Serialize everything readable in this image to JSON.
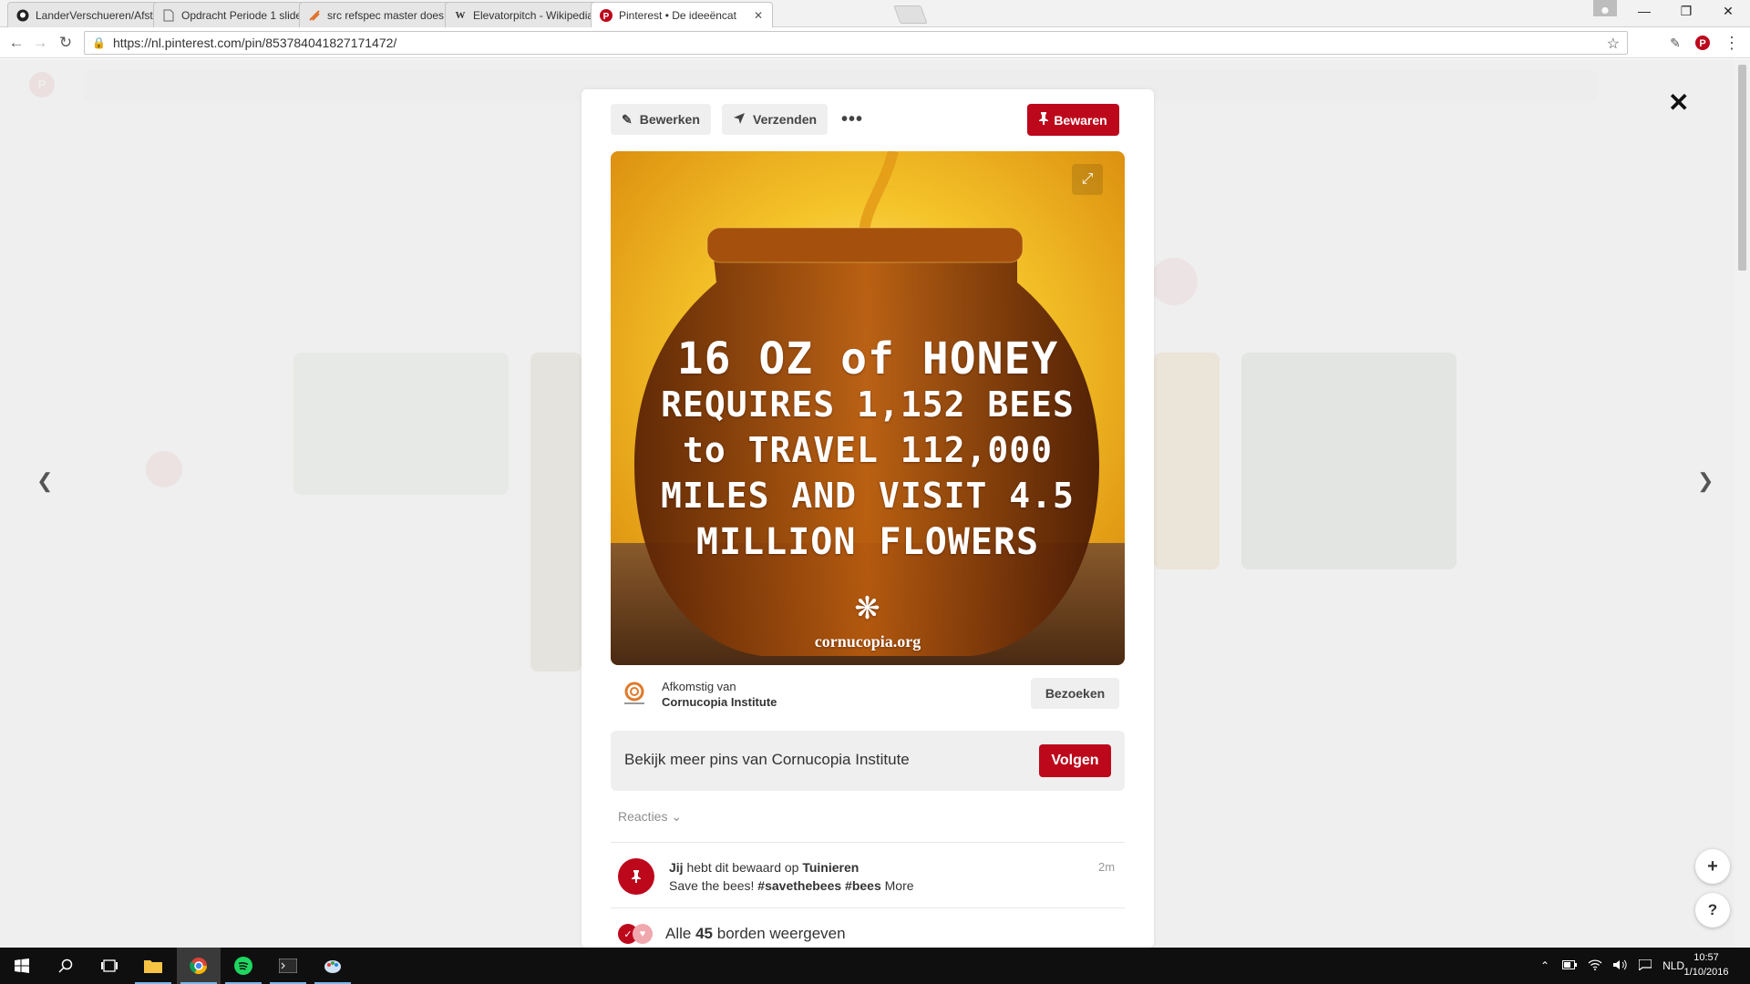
{
  "browser": {
    "tabs": [
      {
        "icon": "github-icon",
        "title": "LanderVerschueren/Afstu"
      },
      {
        "icon": "document-icon",
        "title": "Opdracht Periode 1 slide"
      },
      {
        "icon": "sourcetree-icon",
        "title": "src refspec master does n"
      },
      {
        "icon": "wikipedia-icon",
        "title": "Elevatorpitch - Wikipedia"
      },
      {
        "icon": "pinterest-icon",
        "title": "Pinterest • De ideeëncat"
      }
    ],
    "active_tab": 4,
    "url": "https://nl.pinterest.com/pin/853784041827171472/"
  },
  "modal": {
    "toolbar": {
      "edit_label": "Bewerken",
      "send_label": "Verzenden",
      "more_label": "•••",
      "save_label": "Bewaren"
    },
    "image": {
      "lines": [
        "16 OZ of HONEY",
        "REQUIRES 1,152 BEES",
        "to TRAVEL 112,000",
        "MILES AND VISIT 4.5",
        "MILLION FLOWERS"
      ],
      "website": "cornucopia.org"
    },
    "source": {
      "from_label": "Afkomstig van",
      "name": "Cornucopia Institute",
      "visit_label": "Bezoeken"
    },
    "more_pins": {
      "text": "Bekijk meer pins van Cornucopia Institute",
      "follow_label": "Volgen"
    },
    "reactions_label": "Reacties",
    "activity": {
      "user": "Jij",
      "text": "hebt dit bewaard op",
      "board": "Tuinieren",
      "time": "2m",
      "note_plain": "Save the bees!",
      "hashtags": "#savethebees #bees",
      "more_label": "More"
    },
    "boards": {
      "prefix": "Alle",
      "count": "45",
      "suffix": "borden weergeven"
    }
  },
  "page": {
    "fab_add_label": "+",
    "fab_help_label": "?"
  },
  "taskbar": {
    "language": "NLD",
    "time": "10:57",
    "date": "1/10/2016"
  },
  "colors": {
    "pinterest_red": "#bd081c",
    "honey_gold": "#e8a317"
  }
}
